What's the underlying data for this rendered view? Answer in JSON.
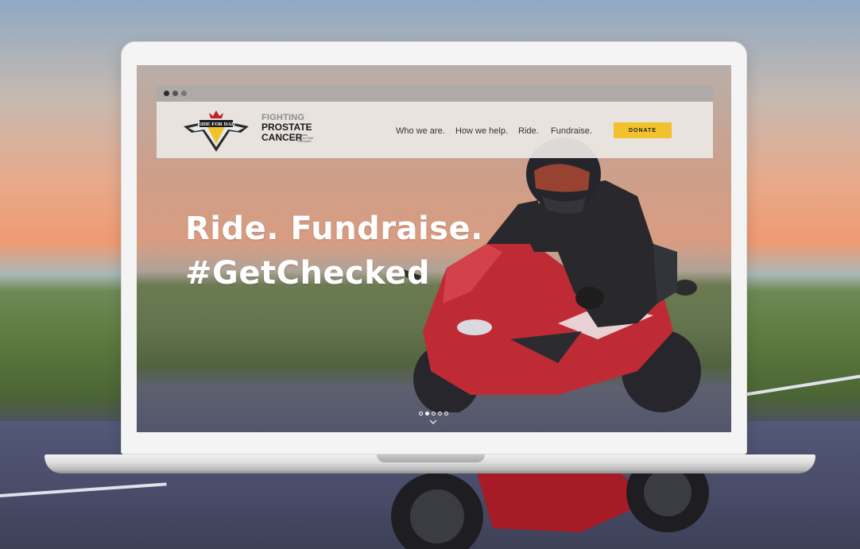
{
  "site": {
    "logo_ride": "RIDE FOR DAD",
    "logo_fpc_line1": "FIGHTING",
    "logo_fpc_line2": "PROSTATE",
    "logo_fpc_line3": "CANCER",
    "logo_fpc_small": "Prostate Cancer Fight Foundation"
  },
  "nav": {
    "items": [
      {
        "label": "Who we are."
      },
      {
        "label": "How we help."
      },
      {
        "label": "Ride."
      },
      {
        "label": "Fundraise."
      }
    ],
    "donate_label": "DONATE"
  },
  "hero": {
    "line1": "Ride. Fundraise.",
    "line2": "#GetChecked"
  },
  "carousel": {
    "slide_count": 5,
    "active_index": 1
  },
  "colors": {
    "donate": "#f2c12e",
    "bike_red": "#c8202b",
    "text_white": "#ffffff"
  }
}
